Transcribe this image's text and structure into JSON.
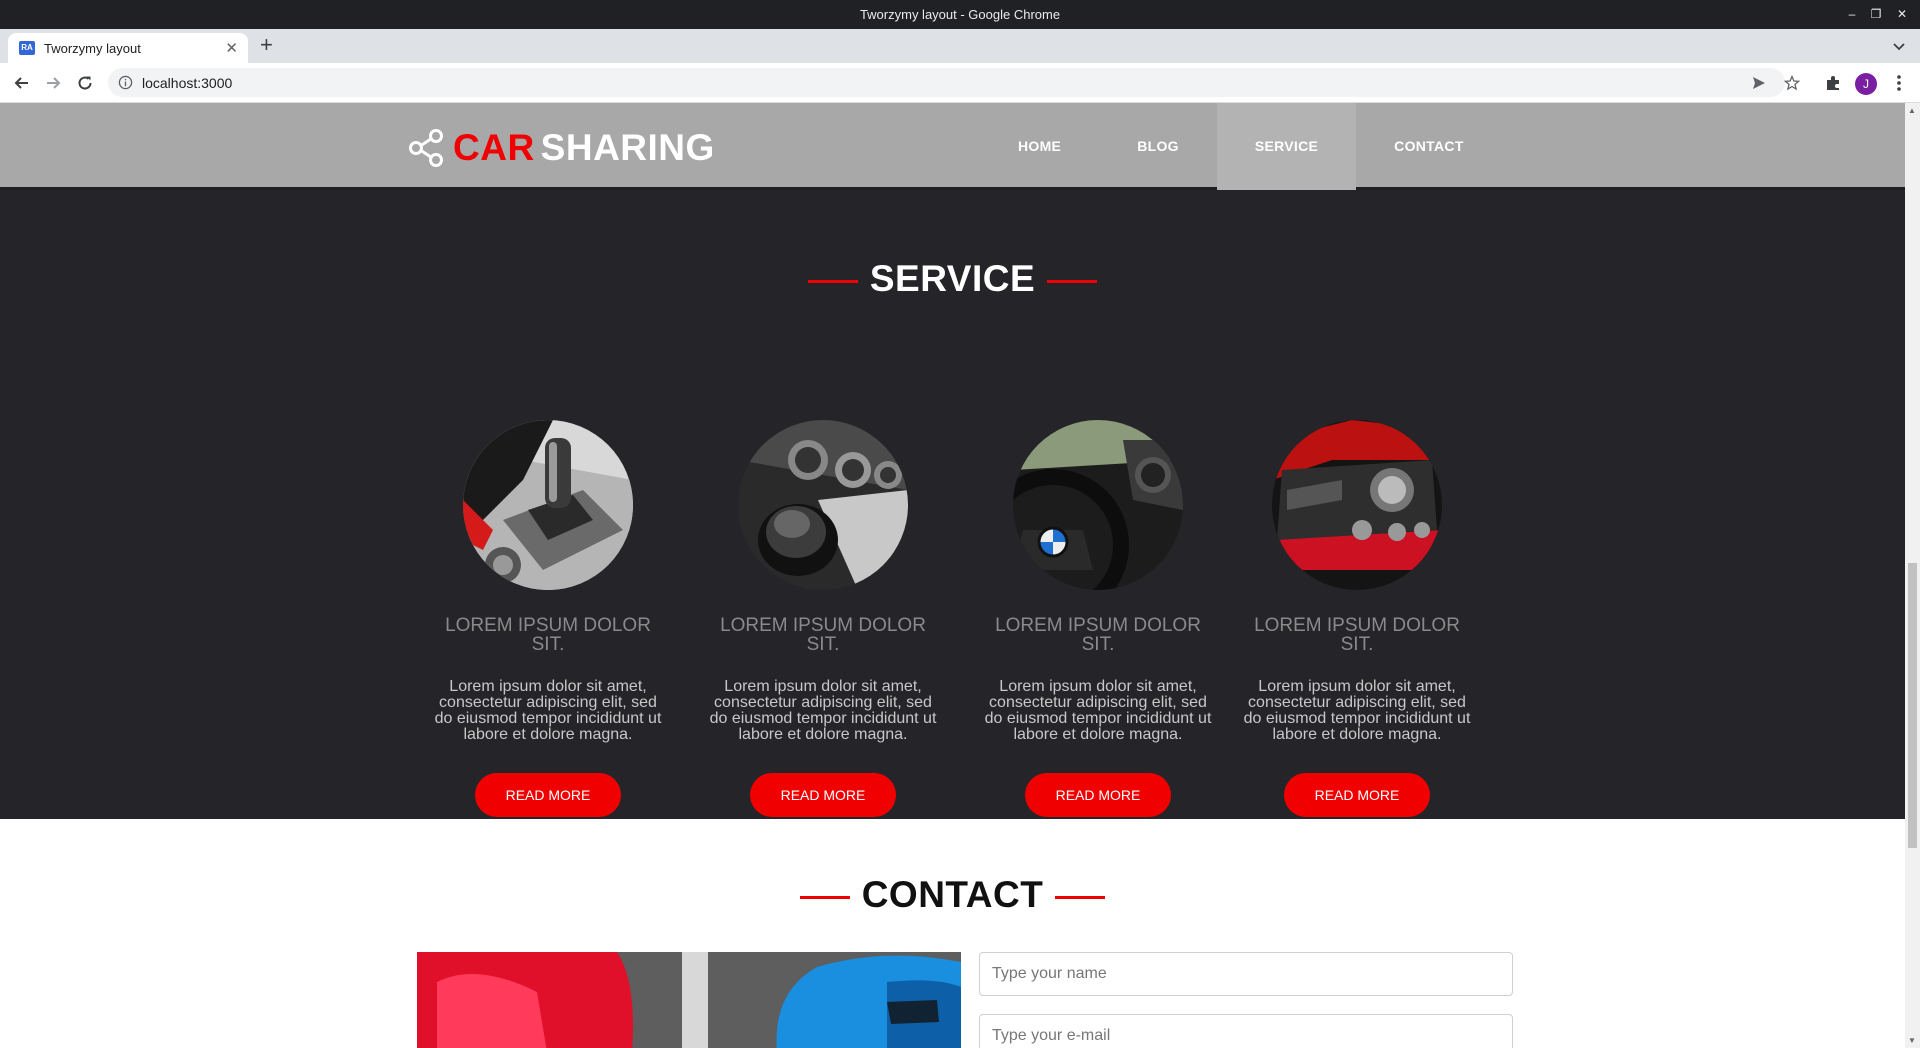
{
  "browser": {
    "window_title": "Tworzymy layout - Google Chrome",
    "tab_title": "Tworzymy layout",
    "tab_favicon_text": "RA",
    "url": "localhost:3000",
    "profile_initial": "J"
  },
  "site": {
    "logo_car": "CAR",
    "logo_sharing": "SHARING",
    "nav": [
      "HOME",
      "BLOG",
      "SERVICE",
      "CONTACT"
    ],
    "active_nav": "SERVICE"
  },
  "service": {
    "title": "SERVICE",
    "cards": [
      {
        "title": "LOREM IPSUM DOLOR SIT.",
        "text": "Lorem ipsum dolor sit amet, consectetur adipiscing elit, sed do eiusmod tempor incididunt ut labore et dolore magna.",
        "button": "READ MORE",
        "image": "gear-shifter-photo"
      },
      {
        "title": "LOREM IPSUM DOLOR SIT.",
        "text": "Lorem ipsum dolor sit amet, consectetur adipiscing elit, sed do eiusmod tempor incididunt ut labore et dolore magna.",
        "button": "READ MORE",
        "image": "manual-gear-knob-photo"
      },
      {
        "title": "LOREM IPSUM DOLOR SIT.",
        "text": "Lorem ipsum dolor sit amet, consectetur adipiscing elit, sed do eiusmod tempor incididunt ut labore et dolore magna.",
        "button": "READ MORE",
        "image": "steering-wheel-photo"
      },
      {
        "title": "LOREM IPSUM DOLOR SIT.",
        "text": "Lorem ipsum dolor sit amet, consectetur adipiscing elit, sed do eiusmod tempor incididunt ut labore et dolore magna.",
        "button": "READ MORE",
        "image": "center-console-photo"
      }
    ]
  },
  "contact": {
    "title": "CONTACT",
    "name_placeholder": "Type your name",
    "email_placeholder": "Type your e-mail"
  },
  "colors": {
    "accent": "#f00000",
    "header_bg": "#a8a8a8",
    "service_bg": "#252428"
  }
}
